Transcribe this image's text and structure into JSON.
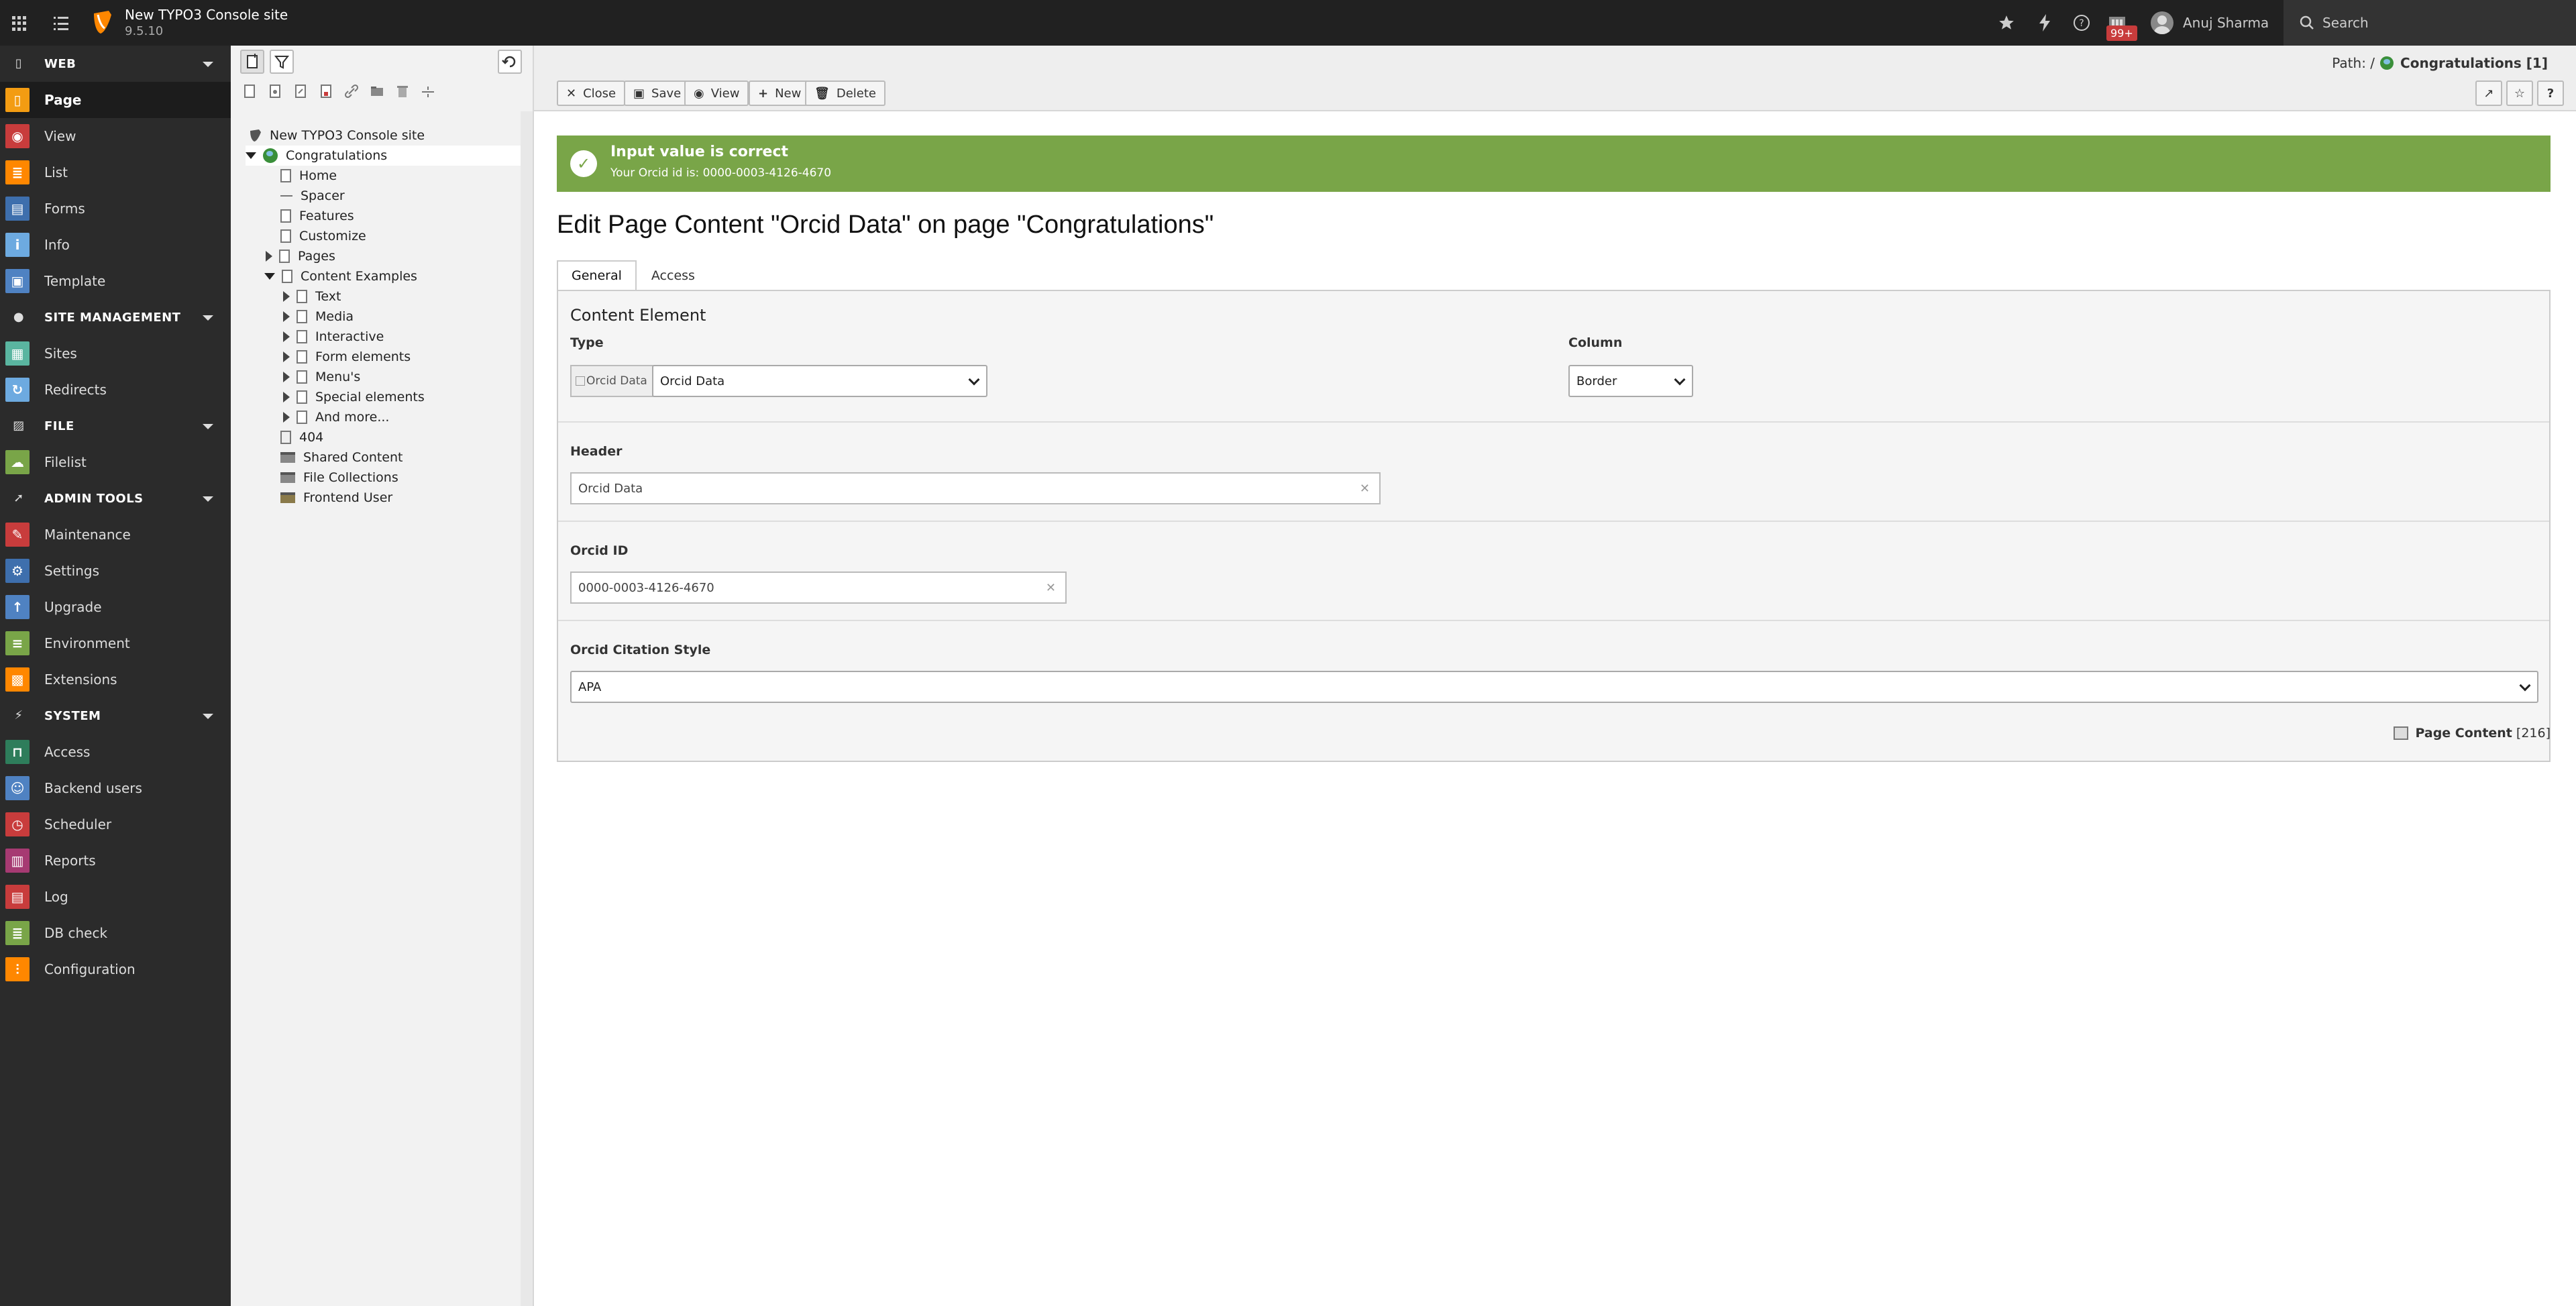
{
  "topbar": {
    "site_title": "New TYPO3 Console site",
    "site_version": "9.5.10",
    "badge_count": "99+",
    "user_name": "Anuj Sharma",
    "search_label": "Search"
  },
  "modulemenu": {
    "groups": [
      {
        "label": "WEB",
        "items": [
          {
            "label": "Page",
            "color": "#f39c12"
          },
          {
            "label": "View",
            "color": "#c83c3c"
          },
          {
            "label": "List",
            "color": "#ff8700"
          },
          {
            "label": "Forms",
            "color": "#3e6fad"
          },
          {
            "label": "Info",
            "color": "#6daae0"
          },
          {
            "label": "Template",
            "color": "#4f82c2"
          }
        ]
      },
      {
        "label": "SITE MANAGEMENT",
        "items": [
          {
            "label": "Sites",
            "color": "#5ab5a0"
          },
          {
            "label": "Redirects",
            "color": "#6daae0"
          }
        ]
      },
      {
        "label": "FILE",
        "items": [
          {
            "label": "Filelist",
            "color": "#79a548"
          }
        ]
      },
      {
        "label": "ADMIN TOOLS",
        "items": [
          {
            "label": "Maintenance",
            "color": "#c83c3c"
          },
          {
            "label": "Settings",
            "color": "#3e6fad"
          },
          {
            "label": "Upgrade",
            "color": "#4f82c2"
          },
          {
            "label": "Environment",
            "color": "#79a548"
          },
          {
            "label": "Extensions",
            "color": "#ff8700"
          }
        ]
      },
      {
        "label": "SYSTEM",
        "items": [
          {
            "label": "Access",
            "color": "#2e7d5b"
          },
          {
            "label": "Backend users",
            "color": "#4f82c2"
          },
          {
            "label": "Scheduler",
            "color": "#c83c3c"
          },
          {
            "label": "Reports",
            "color": "#a63a72"
          },
          {
            "label": "Log",
            "color": "#c83c3c"
          },
          {
            "label": "DB check",
            "color": "#79a548"
          },
          {
            "label": "Configuration",
            "color": "#ff8700"
          }
        ]
      }
    ]
  },
  "tree": {
    "root": "New TYPO3 Console site",
    "nodes": {
      "congratulations": "Congratulations",
      "home": "Home",
      "spacer": "Spacer",
      "features": "Features",
      "customize": "Customize",
      "pages": "Pages",
      "content_examples": "Content Examples",
      "text": "Text",
      "media": "Media",
      "interactive": "Interactive",
      "form_elements": "Form elements",
      "menus": "Menu's",
      "special_elements": "Special elements",
      "and_more": "And more...",
      "p404": "404",
      "shared_content": "Shared Content",
      "file_collections": "File Collections",
      "frontend_user": "Frontend User"
    }
  },
  "docheader": {
    "path_label": "Path: /",
    "path_page": "Congratulations [1]",
    "buttons": {
      "close": "Close",
      "save": "Save",
      "view": "View",
      "new": "New",
      "delete": "Delete"
    }
  },
  "callout": {
    "title": "Input value is correct",
    "message": "Your Orcid id is: 0000-0003-4126-4670"
  },
  "page_title": "Edit Page Content \"Orcid Data\" on page \"Congratulations\"",
  "tabs": [
    "General",
    "Access"
  ],
  "form": {
    "legend": "Content Element",
    "type_label": "Type",
    "type_icon_alt": "Orcid Data",
    "type_value": "Orcid Data",
    "column_label": "Column",
    "column_value": "Border",
    "header_label": "Header",
    "header_value": "Orcid Data",
    "orcid_label": "Orcid ID",
    "orcid_value": "0000-0003-4126-4670",
    "style_label": "Orcid Citation Style",
    "style_value": "APA"
  },
  "record_info": {
    "table": "Page Content",
    "uid": "[216]"
  }
}
